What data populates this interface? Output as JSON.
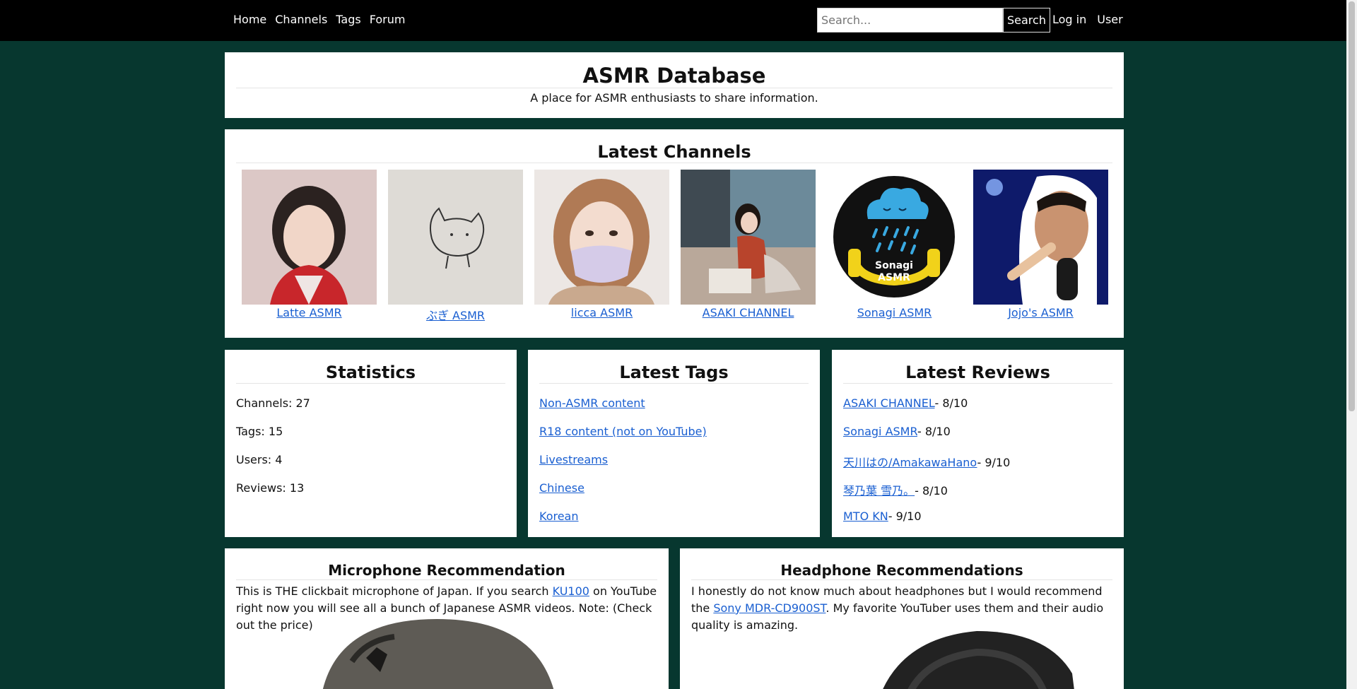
{
  "nav": {
    "links": [
      "Home",
      "Channels",
      "Tags",
      "Forum"
    ],
    "search_placeholder": "Search...",
    "search_button": "Search",
    "login": "Log in",
    "user": "User"
  },
  "hero": {
    "title": "ASMR Database",
    "subtitle": "A place for ASMR enthusiasts to share information."
  },
  "channels": {
    "title": "Latest Channels",
    "items": [
      {
        "name": "Latte ASMR"
      },
      {
        "name": "ぶぎ ASMR"
      },
      {
        "name": "licca ASMR"
      },
      {
        "name": "ASAKI CHANNEL"
      },
      {
        "name": "Sonagi ASMR",
        "logo_text": [
          "Sonagi",
          "ASMR"
        ]
      },
      {
        "name": "Jojo's ASMR"
      }
    ]
  },
  "statistics": {
    "title": "Statistics",
    "items": [
      "Channels: 27",
      "Tags: 15",
      "Users: 4",
      "Reviews: 13"
    ]
  },
  "tags": {
    "title": "Latest Tags",
    "items": [
      "Non-ASMR content",
      "R18 content (not on YouTube)",
      "Livestreams",
      "Chinese",
      "Korean"
    ]
  },
  "reviews": {
    "title": "Latest Reviews",
    "items": [
      {
        "channel": "ASAKI CHANNEL",
        "score": "- 8/10"
      },
      {
        "channel": "Sonagi ASMR",
        "score": "- 8/10"
      },
      {
        "channel": "天川はの/AmakawaHano",
        "score": "- 9/10"
      },
      {
        "channel": "琴乃葉 雪乃。",
        "score": "- 8/10"
      },
      {
        "channel": "MTO KN",
        "score": "- 9/10"
      }
    ]
  },
  "microphone": {
    "title": "Microphone Recommendation",
    "text_before": "This is THE clickbait microphone of Japan. If you search ",
    "link": "KU100",
    "text_after": " on YouTube right now you will see all a bunch of Japanese ASMR videos. Note: (Check out the price)"
  },
  "headphones": {
    "title": "Headphone Recommendations",
    "text_before": "I honestly do not know much about headphones but I would recommend the ",
    "link": "Sony MDR-CD900ST",
    "text_after": ". My favorite YouTuber uses them and their audio quality is amazing."
  },
  "colors": {
    "page_background": "#07372f",
    "navbar": "#000000",
    "link": "#1a5fd1"
  }
}
